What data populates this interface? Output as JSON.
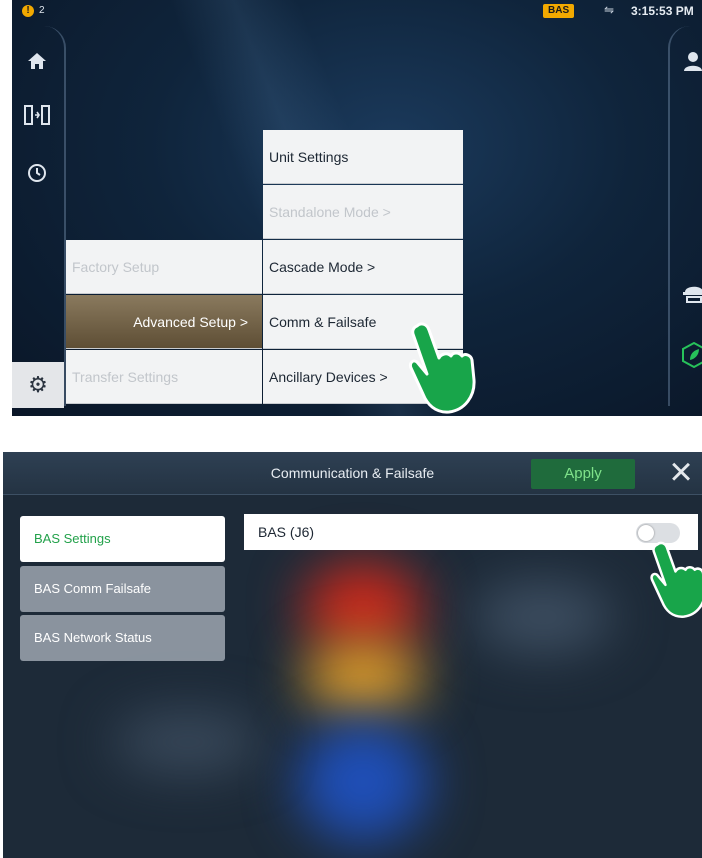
{
  "step1": {
    "status": {
      "alert_count": "2",
      "bas_badge": "BAS",
      "time": "3:15:53 PM",
      "alert_icon": "warning-icon",
      "usb_icon": "usb-icon"
    },
    "left_rail_icons": [
      "home-icon",
      "transfer-icon",
      "history-icon",
      "gear-icon"
    ],
    "right_rail_icons": [
      "user-icon",
      "technician-icon",
      "leaf-icon"
    ],
    "menu_column1": [
      {
        "label": "Factory Setup",
        "state": "dim"
      },
      {
        "label": "Advanced Setup >",
        "state": "active"
      },
      {
        "label": "Transfer Settings",
        "state": "dim"
      }
    ],
    "menu_column2": [
      {
        "label": "Unit Settings",
        "state": "normal"
      },
      {
        "label": "Standalone Mode  >",
        "state": "dim"
      },
      {
        "label": "Cascade Mode     >",
        "state": "normal"
      },
      {
        "label": "Comm & Failsafe",
        "state": "normal"
      },
      {
        "label": "Ancillary Devices >",
        "state": "normal"
      }
    ],
    "pointer_icon": "pointing-hand-icon"
  },
  "step2": {
    "title": "Communication & Failsafe",
    "apply_label": "Apply",
    "close_icon": "close-icon",
    "tabs": [
      {
        "label": "BAS Settings",
        "selected": true
      },
      {
        "label": "BAS Comm Failsafe",
        "selected": false
      },
      {
        "label": "BAS Network Status",
        "selected": false
      }
    ],
    "setting": {
      "label": "BAS (J6)",
      "enabled": false
    },
    "pointer_icon": "pointing-hand-icon",
    "colors": {
      "accent_green": "#22a14a",
      "apply_bg": "#1f6b3c",
      "badge": "#f2a900"
    }
  }
}
